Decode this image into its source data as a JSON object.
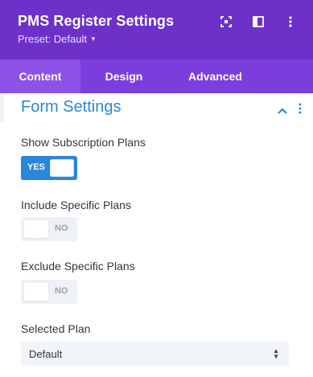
{
  "header": {
    "title": "PMS Register Settings",
    "preset_label": "Preset: Default",
    "icons": [
      "expand-icon",
      "sidebar-icon",
      "more-vertical-icon"
    ]
  },
  "tabs": [
    {
      "label": "Content",
      "active": true
    },
    {
      "label": "Design",
      "active": false
    },
    {
      "label": "Advanced",
      "active": false
    }
  ],
  "section": {
    "title": "Form Settings",
    "icons": [
      "chevron-up-icon",
      "more-vertical-icon"
    ]
  },
  "fields": {
    "show_subscription_plans": {
      "label": "Show Subscription Plans",
      "toggle_text": "YES",
      "value": true
    },
    "include_specific_plans": {
      "label": "Include Specific Plans",
      "toggle_text": "NO",
      "value": false
    },
    "exclude_specific_plans": {
      "label": "Exclude Specific Plans",
      "toggle_text": "NO",
      "value": false
    },
    "selected_plan": {
      "label": "Selected Plan",
      "value": "Default"
    }
  },
  "colors": {
    "header_bg": "#6d30c9",
    "tabs_bg": "#7b3edd",
    "active_tab_bg": "#8c52e6",
    "accent_blue": "#2b87da",
    "toggle_off_bg": "#eef1f5"
  }
}
